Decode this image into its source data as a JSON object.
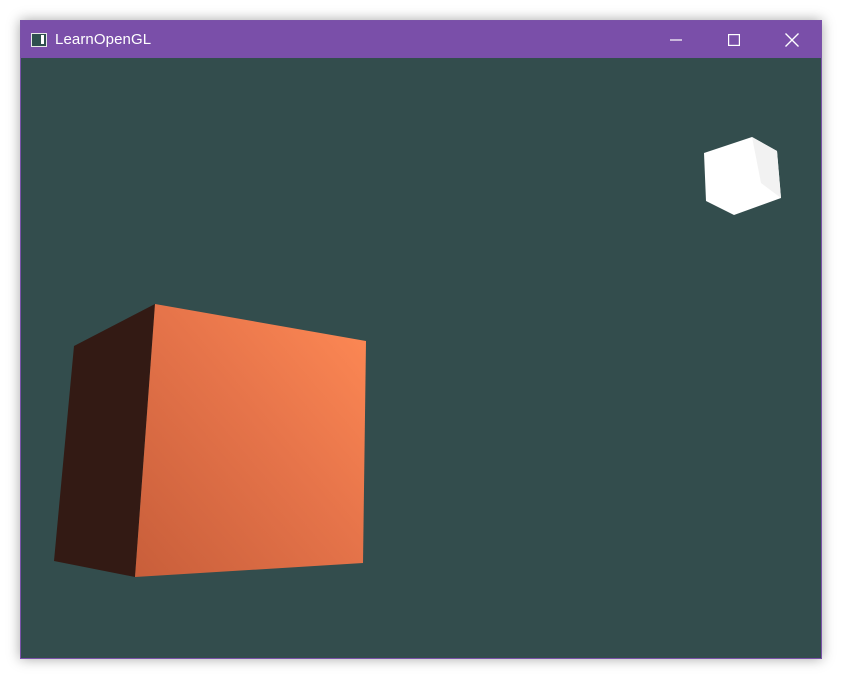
{
  "window": {
    "title": "LearnOpenGL",
    "title_bar_color": "#7a4fa9",
    "icon": "app-window-icon",
    "controls": [
      {
        "name": "minimize",
        "icon": "minimize-icon"
      },
      {
        "name": "maximize",
        "icon": "maximize-icon"
      },
      {
        "name": "close",
        "icon": "close-icon"
      }
    ]
  },
  "scene": {
    "clear_color": "#334d4d",
    "objects": [
      {
        "name": "lit-cube",
        "color": "#ff8050",
        "shadow_side_color": "#331a14"
      },
      {
        "name": "light-source-cube",
        "color": "#ffffff"
      }
    ]
  }
}
